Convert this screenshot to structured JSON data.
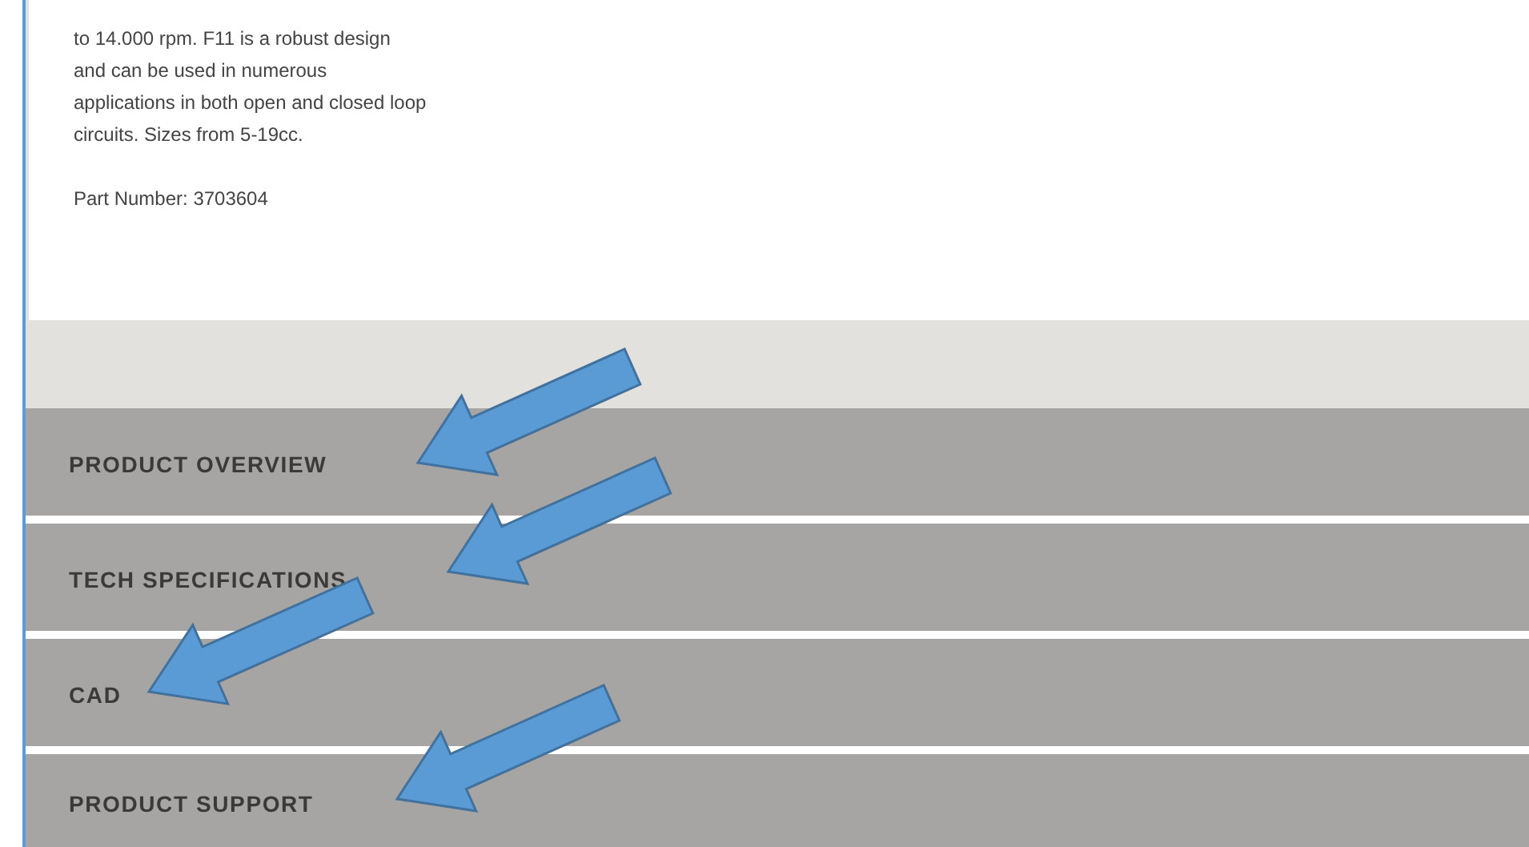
{
  "product": {
    "description_lines": [
      "to 14.000 rpm. F11 is a robust design",
      "and can be used in numerous",
      "applications in both open and closed loop",
      "circuits. Sizes from 5-19cc."
    ],
    "part_number": "Part Number: 3703604"
  },
  "accordion": [
    {
      "label": "PRODUCT OVERVIEW"
    },
    {
      "label": "TECH SPECIFICATIONS"
    },
    {
      "label": "CAD"
    },
    {
      "label": "PRODUCT SUPPORT"
    }
  ]
}
